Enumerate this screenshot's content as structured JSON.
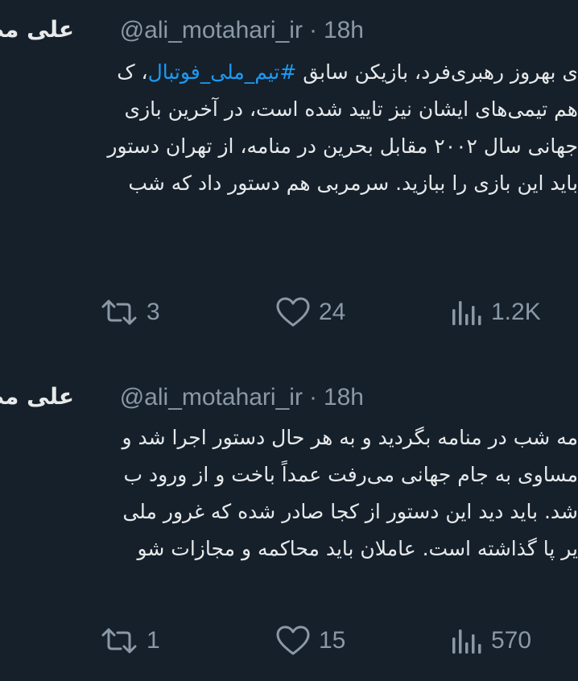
{
  "theme": {
    "background": "#15202b",
    "text": "#e7e9ea",
    "muted": "#8b98a5",
    "link": "#1d9bf0"
  },
  "tweets": [
    {
      "author": {
        "display_name": "علی مطهری",
        "handle": "@ali_motahari_ir",
        "separator": "·",
        "time": "18h"
      },
      "lines": [
        {
          "before": "ی بهروز رهبری‌فرد، بازیکن سابق ",
          "hashtag": "#تیم_ملی_فوتبال",
          "after": "، ک"
        },
        {
          "text": "هم تیمی‌های ایشان نیز تایید شده است، در آخرین بازی"
        },
        {
          "text": "جهانی سال ۲۰۰۲ مقابل بحرین در منامه، از تهران دستور"
        },
        {
          "text": "باید این بازی را ببازید. سرمربی هم دستور داد که شب"
        }
      ],
      "actions": {
        "retweets": "3",
        "likes": "24",
        "views": "1.2K"
      }
    },
    {
      "author": {
        "display_name": "علی مطهری",
        "handle": "@ali_motahari_ir",
        "separator": "·",
        "time": "18h"
      },
      "lines": [
        {
          "text": "مه شب در منامه بگردید و به هر حال دستور اجرا شد و"
        },
        {
          "text": "مساوی به جام جهانی می‌رفت  عمداً باخت و از ورود ب"
        },
        {
          "text": "شد. باید دید این دستور از کجا صادر شده که غرور ملی"
        },
        {
          "text": "یر پا گذاشته است. عاملان باید محاکمه و مجازات شو"
        }
      ],
      "actions": {
        "retweets": "1",
        "likes": "15",
        "views": "570"
      }
    }
  ]
}
